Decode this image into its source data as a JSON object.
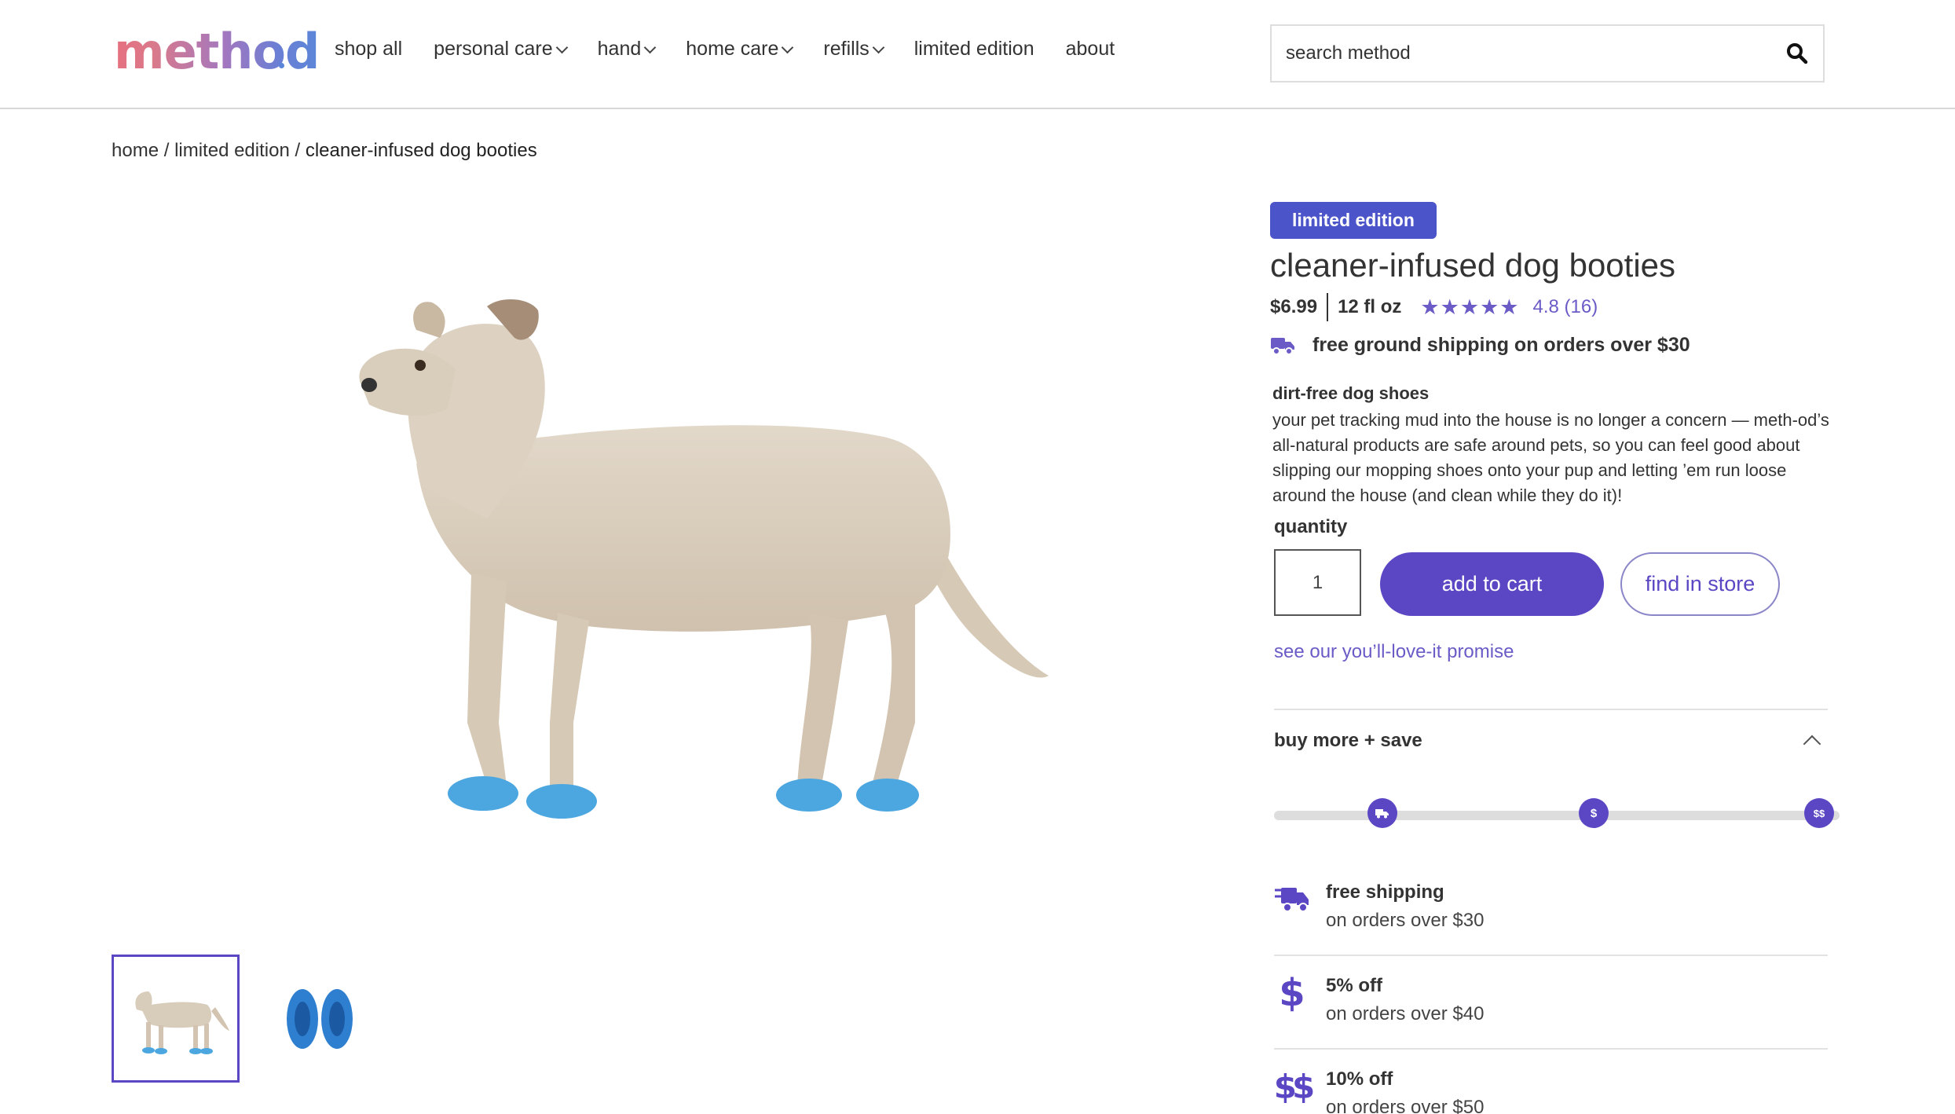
{
  "brand": {
    "logo_text": "method",
    "accent": "#5b47c4"
  },
  "nav": {
    "items": [
      {
        "label": "shop all",
        "dropdown": false
      },
      {
        "label": "personal care",
        "dropdown": true
      },
      {
        "label": "hand",
        "dropdown": true
      },
      {
        "label": "home care",
        "dropdown": true
      },
      {
        "label": "refills",
        "dropdown": true
      },
      {
        "label": "limited edition",
        "dropdown": false
      },
      {
        "label": "about",
        "dropdown": false
      }
    ]
  },
  "search": {
    "placeholder": "search method",
    "icon": "search-icon"
  },
  "breadcrumb": {
    "home": "home",
    "sep": " / ",
    "category": "limited edition",
    "current": "cleaner-infused dog booties"
  },
  "product": {
    "badge": "limited edition",
    "title": "cleaner-infused dog booties",
    "price": "$6.99",
    "size": "12 fl oz",
    "rating_value": 4.8,
    "rating_text": "4.8 (16)",
    "shipping_note": "free ground shipping on orders over $30",
    "desc_heading": "dirt-free dog shoes",
    "description": "your pet tracking mud into the house is no longer a concern — meth-od’s all-natural products are safe around pets, so you can feel good about slipping our mopping shoes onto your pup and letting ’em run loose around the house (and clean while they do it)!",
    "quantity_label": "quantity",
    "quantity_value": "1",
    "add_to_cart": "add to cart",
    "find_in_store": "find in store",
    "promise_link": "see our you’ll-love-it promise"
  },
  "buy_more": {
    "heading": "buy more + save",
    "markers": [
      "truck",
      "$",
      "$$"
    ],
    "tiers": [
      {
        "icon": "truck-icon",
        "title": "free shipping",
        "subtitle": "on orders over $30"
      },
      {
        "icon": "dollar-icon",
        "title": "5% off",
        "subtitle": "on orders over $40"
      },
      {
        "icon": "double-dollar-icon",
        "title": "10% off",
        "subtitle": "on orders over $50"
      }
    ]
  },
  "gallery": {
    "thumbnails": [
      "dog-thumbnail",
      "booties-thumbnail"
    ],
    "selected": 0
  }
}
